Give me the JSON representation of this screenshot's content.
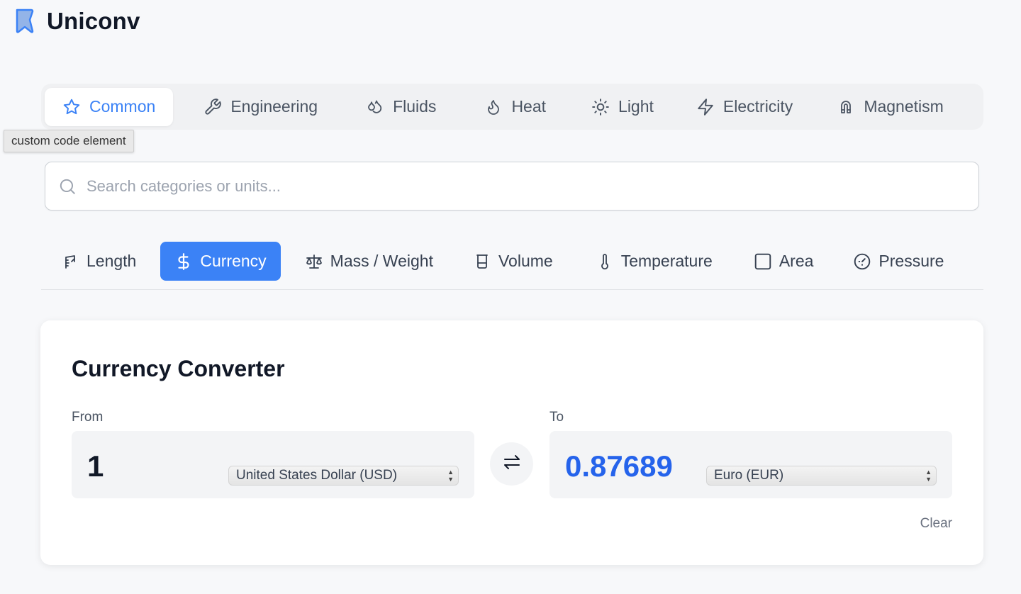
{
  "app": {
    "title": "Uniconv"
  },
  "group_tabs": [
    {
      "label": "Common",
      "icon": "star-icon"
    },
    {
      "label": "Engineering",
      "icon": "wrench-icon"
    },
    {
      "label": "Fluids",
      "icon": "droplets-icon"
    },
    {
      "label": "Heat",
      "icon": "flame-icon"
    },
    {
      "label": "Light",
      "icon": "sun-icon"
    },
    {
      "label": "Electricity",
      "icon": "zap-icon"
    },
    {
      "label": "Magnetism",
      "icon": "magnet-icon"
    }
  ],
  "active_group": "Common",
  "tooltip": {
    "text": "custom code element"
  },
  "search": {
    "placeholder": "Search categories or units..."
  },
  "category_tabs": [
    {
      "label": "Length",
      "icon": "ruler-icon"
    },
    {
      "label": "Currency",
      "icon": "dollar-icon"
    },
    {
      "label": "Mass / Weight",
      "icon": "scale-icon"
    },
    {
      "label": "Volume",
      "icon": "beaker-icon"
    },
    {
      "label": "Temperature",
      "icon": "thermometer-icon"
    },
    {
      "label": "Area",
      "icon": "square-icon"
    },
    {
      "label": "Pressure",
      "icon": "gauge-icon"
    }
  ],
  "active_category": "Currency",
  "converter": {
    "title": "Currency Converter",
    "from_label": "From",
    "to_label": "To",
    "from_value": "1",
    "to_value": "0.87689",
    "from_unit": "United States Dollar (USD)",
    "to_unit": "Euro (EUR)",
    "clear_label": "Clear"
  },
  "colors": {
    "accent": "#3b82f6",
    "result": "#2563eb",
    "background": "#f7f8fa",
    "text": "#111827",
    "muted": "#4b5563"
  }
}
